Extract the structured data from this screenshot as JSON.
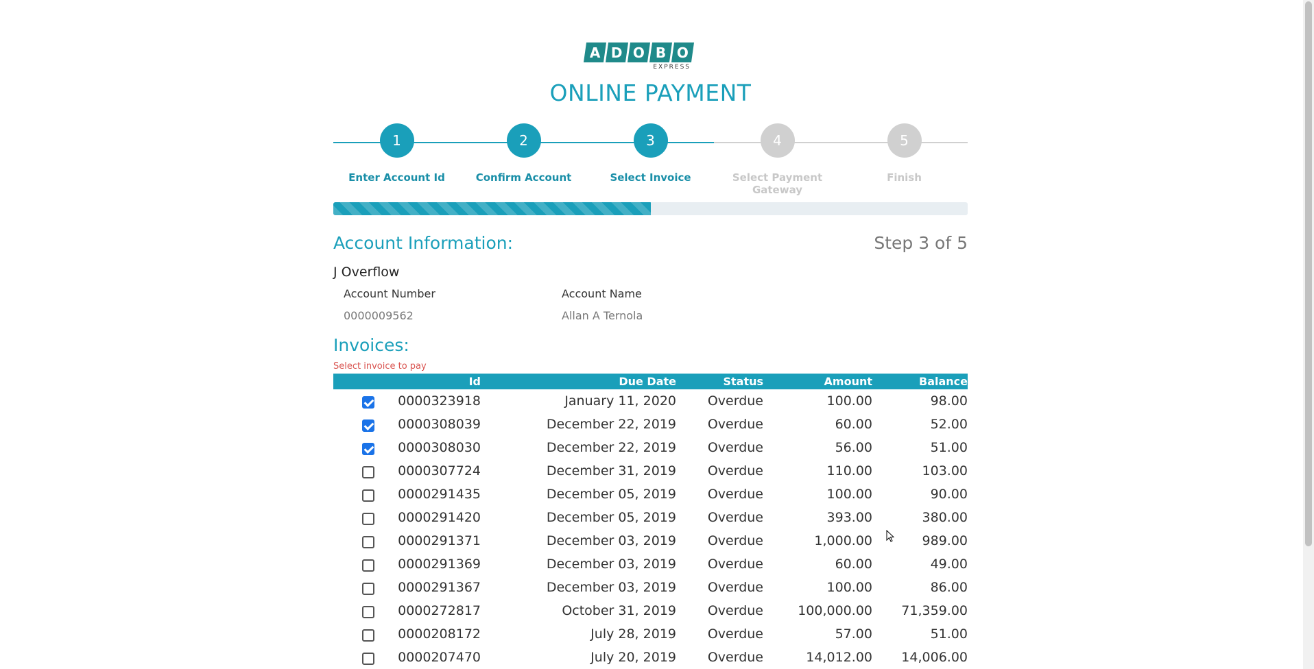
{
  "logo": {
    "letters": [
      "A",
      "D",
      "O",
      "B",
      "O"
    ],
    "sub": "EXPRESS",
    "color": "#1f8a8a"
  },
  "title": "ONLINE PAYMENT",
  "accent": "#1a9fba",
  "stepper": {
    "steps": [
      {
        "num": "1",
        "label": "Enter Account Id",
        "active": true
      },
      {
        "num": "2",
        "label": "Confirm Account",
        "active": true
      },
      {
        "num": "3",
        "label": "Select Invoice",
        "active": true
      },
      {
        "num": "4",
        "label": "Select Payment Gateway",
        "active": false
      },
      {
        "num": "5",
        "label": "Finish",
        "active": false
      }
    ],
    "progress_percent": 50
  },
  "account": {
    "heading": "Account Information:",
    "step_text": "Step 3 of 5",
    "holder": "J Overflow",
    "number_label": "Account Number",
    "number_value": "0000009562",
    "name_label": "Account Name",
    "name_value": "Allan A Ternola"
  },
  "invoices": {
    "heading": "Invoices:",
    "hint": "Select invoice to pay",
    "columns": [
      "Id",
      "Due Date",
      "Status",
      "Amount",
      "Balance"
    ],
    "rows": [
      {
        "checked": true,
        "id": "0000323918",
        "due": "January 11, 2020",
        "status": "Overdue",
        "amount": "100.00",
        "balance": "98.00"
      },
      {
        "checked": true,
        "id": "0000308039",
        "due": "December 22, 2019",
        "status": "Overdue",
        "amount": "60.00",
        "balance": "52.00"
      },
      {
        "checked": true,
        "id": "0000308030",
        "due": "December 22, 2019",
        "status": "Overdue",
        "amount": "56.00",
        "balance": "51.00"
      },
      {
        "checked": false,
        "id": "0000307724",
        "due": "December 31, 2019",
        "status": "Overdue",
        "amount": "110.00",
        "balance": "103.00"
      },
      {
        "checked": false,
        "id": "0000291435",
        "due": "December 05, 2019",
        "status": "Overdue",
        "amount": "100.00",
        "balance": "90.00"
      },
      {
        "checked": false,
        "id": "0000291420",
        "due": "December 05, 2019",
        "status": "Overdue",
        "amount": "393.00",
        "balance": "380.00"
      },
      {
        "checked": false,
        "id": "0000291371",
        "due": "December 03, 2019",
        "status": "Overdue",
        "amount": "1,000.00",
        "balance": "989.00"
      },
      {
        "checked": false,
        "id": "0000291369",
        "due": "December 03, 2019",
        "status": "Overdue",
        "amount": "60.00",
        "balance": "49.00"
      },
      {
        "checked": false,
        "id": "0000291367",
        "due": "December 03, 2019",
        "status": "Overdue",
        "amount": "100.00",
        "balance": "86.00"
      },
      {
        "checked": false,
        "id": "0000272817",
        "due": "October 31, 2019",
        "status": "Overdue",
        "amount": "100,000.00",
        "balance": "71,359.00"
      },
      {
        "checked": false,
        "id": "0000208172",
        "due": "July 28, 2019",
        "status": "Overdue",
        "amount": "57.00",
        "balance": "51.00"
      },
      {
        "checked": false,
        "id": "0000207470",
        "due": "July 20, 2019",
        "status": "Overdue",
        "amount": "14,012.00",
        "balance": "14,006.00"
      }
    ]
  }
}
